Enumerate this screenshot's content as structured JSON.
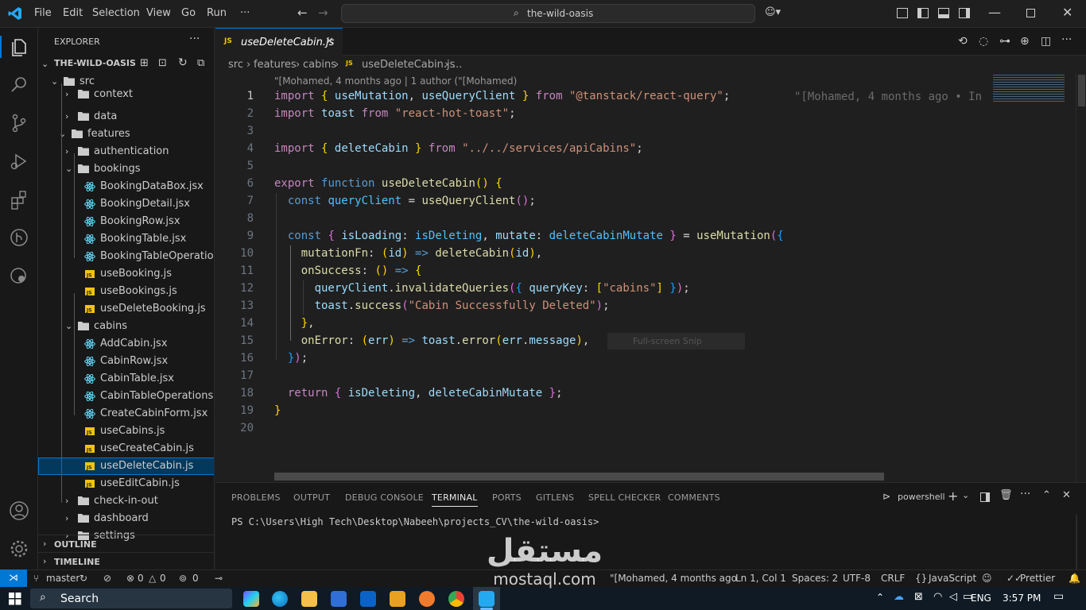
{
  "titlebar": {
    "menu": [
      "File",
      "Edit",
      "Selection",
      "View",
      "Go",
      "Run",
      "···"
    ],
    "search": "the-wild-oasis"
  },
  "explorer": {
    "title": "EXPLORER",
    "workspace": "THE-WILD-OASIS",
    "tree": [
      {
        "label": "src",
        "type": "folder-open"
      },
      {
        "label": "context",
        "type": "folder"
      },
      {
        "label": "data",
        "type": "folder"
      },
      {
        "label": "features",
        "type": "folder-open"
      },
      {
        "label": "authentication",
        "type": "folder"
      },
      {
        "label": "bookings",
        "type": "folder-open"
      },
      {
        "label": "BookingDataBox.jsx",
        "type": "react"
      },
      {
        "label": "BookingDetail.jsx",
        "type": "react"
      },
      {
        "label": "BookingRow.jsx",
        "type": "react"
      },
      {
        "label": "BookingTable.jsx",
        "type": "react"
      },
      {
        "label": "BookingTableOperatio...",
        "type": "react"
      },
      {
        "label": "useBooking.js",
        "type": "js"
      },
      {
        "label": "useBookings.js",
        "type": "js"
      },
      {
        "label": "useDeleteBooking.js",
        "type": "js"
      },
      {
        "label": "cabins",
        "type": "folder-open"
      },
      {
        "label": "AddCabin.jsx",
        "type": "react"
      },
      {
        "label": "CabinRow.jsx",
        "type": "react"
      },
      {
        "label": "CabinTable.jsx",
        "type": "react"
      },
      {
        "label": "CabinTableOperations.j...",
        "type": "react"
      },
      {
        "label": "CreateCabinForm.jsx",
        "type": "react"
      },
      {
        "label": "useCabins.js",
        "type": "js"
      },
      {
        "label": "useCreateCabin.js",
        "type": "js"
      },
      {
        "label": "useDeleteCabin.js",
        "type": "js",
        "selected": true
      },
      {
        "label": "useEditCabin.js",
        "type": "js"
      },
      {
        "label": "check-in-out",
        "type": "folder"
      },
      {
        "label": "dashboard",
        "type": "folder"
      },
      {
        "label": "settings",
        "type": "folder"
      }
    ],
    "outline": "OUTLINE",
    "timeline": "TIMELINE"
  },
  "editor": {
    "tab_label": "useDeleteCabin.js",
    "breadcrumb": [
      "src",
      "features",
      "cabins",
      "useDeleteCabin.js",
      "..."
    ],
    "codelens": "\"[Mohamed, 4 months ago | 1 author (\"[Mohamed)",
    "blame": "\"[Mohamed, 4 months ago • In",
    "snip_hint": "Full-screen Snip",
    "line_numbers": [
      "1",
      "2",
      "3",
      "4",
      "5",
      "6",
      "7",
      "8",
      "9",
      "10",
      "11",
      "12",
      "13",
      "14",
      "15",
      "16",
      "17",
      "18",
      "19",
      "20"
    ]
  },
  "panel": {
    "tabs": [
      "PROBLEMS",
      "OUTPUT",
      "DEBUG CONSOLE",
      "TERMINAL",
      "PORTS",
      "GITLENS",
      "SPELL CHECKER",
      "COMMENTS"
    ],
    "active_tab": "TERMINAL",
    "shell": "powershell",
    "prompt": "PS C:\\Users\\High Tech\\Desktop\\Nabeeh\\projects_CV\\the-wild-oasis>"
  },
  "statusbar": {
    "branch": "master",
    "errors": "0",
    "warnings": "0",
    "ports": "0",
    "blame": "\"[Mohamed, 4 months ago",
    "position": "Ln 1, Col 1",
    "spaces": "Spaces: 2",
    "encoding": "UTF-8",
    "eol": "CRLF",
    "language": "JavaScript",
    "formatter": "Prettier"
  },
  "taskbar": {
    "search": "Search",
    "lang": "ENG",
    "time": "3:57 PM"
  },
  "watermark": {
    "arabic": "مستقل",
    "latin": "mostaql.com"
  },
  "colors": {
    "accent": "#0078d4",
    "selection": "#04395e",
    "keyword": "#569cd6",
    "control": "#c586c0",
    "function": "#dcdcaa",
    "variable": "#9cdcfe",
    "string": "#ce9178"
  }
}
